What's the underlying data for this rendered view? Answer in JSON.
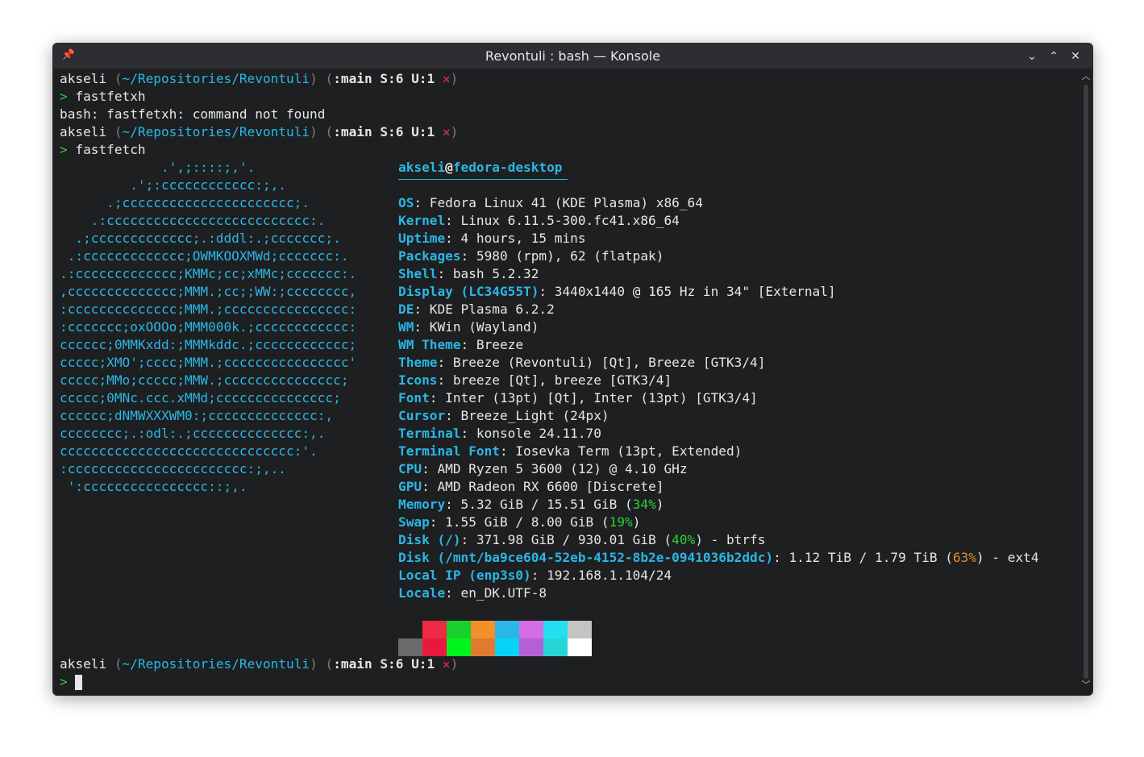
{
  "window": {
    "title": "Revontuli : bash — Konsole",
    "pin_icon": "📌",
    "minimize_icon": "⌄",
    "maximize_icon": "⌃",
    "close_icon": "✕"
  },
  "prompt": {
    "user": "akseli",
    "dir_open": "(",
    "dir": "~/Repositories/Revontuli",
    "dir_close": ")",
    "git_open": "(",
    "git_icon": "",
    "git_branch": ":main",
    "git_status": "S:6 U:1",
    "error_mark": "✕",
    "git_close": ")",
    "arrow": ">"
  },
  "commands": {
    "first": "fastfetxh",
    "error": "bash: fastfetxh: command not found",
    "second": "fastfetch"
  },
  "logo": [
    "             .',;::::;,'.",
    "         .';:cccccccccccc:;,.",
    "      .;cccccccccccccccccccccc;.",
    "    .:cccccccccccccccccccccccccc:.",
    "  .;ccccccccccccc;.:dddl:.;ccccccc;.",
    " .:ccccccccccccc;OWMKOOXMWd;ccccccc:.",
    ".:ccccccccccccc;KMMc;cc;xMMc;ccccccc:.",
    ",cccccccccccccc;MMM.;cc;;WW:;cccccccc,",
    ":cccccccccccccc;MMM.;cccccccccccccccc:",
    ":ccccccc;oxOOOo;MMM000k.;cccccccccccc:",
    "cccccc;0MMKxdd:;MMMkddc.;cccccccccccc;",
    "ccccc;XMO';cccc;MMM.;cccccccccccccccc'",
    "ccccc;MMo;ccccc;MMW.;ccccccccccccccc;",
    "ccccc;0MNc.ccc.xMMd;ccccccccccccccc;",
    "cccccc;dNMWXXXWM0:;cccccccccccccc:,",
    "cccccccc;.:odl:.;cccccccccccccc:,.",
    "cccccccccccccccccccccccccccccc:'.",
    ":ccccccccccccccccccccccc:;,..",
    " ':cccccccccccccccc::;,."
  ],
  "info": {
    "user": "akseli",
    "at": "@",
    "host": "fedora-desktop",
    "rows": [
      {
        "key": "OS",
        "value": ": Fedora Linux 41 (KDE Plasma) x86_64"
      },
      {
        "key": "Kernel",
        "value": ": Linux 6.11.5-300.fc41.x86_64"
      },
      {
        "key": "Uptime",
        "value": ": 4 hours, 15 mins"
      },
      {
        "key": "Packages",
        "value": ": 5980 (rpm), 62 (flatpak)"
      },
      {
        "key": "Shell",
        "value": ": bash 5.2.32"
      },
      {
        "key": "Display (LC34G55T)",
        "value": ": 3440x1440 @ 165 Hz in 34\" [External]"
      },
      {
        "key": "DE",
        "value": ": KDE Plasma 6.2.2"
      },
      {
        "key": "WM",
        "value": ": KWin (Wayland)"
      },
      {
        "key": "WM Theme",
        "value": ": Breeze"
      },
      {
        "key": "Theme",
        "value": ": Breeze (Revontuli) [Qt], Breeze [GTK3/4]"
      },
      {
        "key": "Icons",
        "value": ": breeze [Qt], breeze [GTK3/4]"
      },
      {
        "key": "Font",
        "value": ": Inter (13pt) [Qt], Inter (13pt) [GTK3/4]"
      },
      {
        "key": "Cursor",
        "value": ": Breeze_Light (24px)"
      },
      {
        "key": "Terminal",
        "value": ": konsole 24.11.70"
      },
      {
        "key": "Terminal Font",
        "value": ": Iosevka Term (13pt, Extended)"
      },
      {
        "key": "CPU",
        "value": ": AMD Ryzen 5 3600 (12) @ 4.10 GHz"
      },
      {
        "key": "GPU",
        "value": ": AMD Radeon RX 6600 [Discrete]"
      }
    ],
    "memory": {
      "key": "Memory",
      "pre": ": 5.32 GiB / 15.51 GiB (",
      "pct": "34%",
      "post": ")"
    },
    "swap": {
      "key": "Swap",
      "pre": ": 1.55 GiB / 8.00 GiB (",
      "pct": "19%",
      "post": ")"
    },
    "disk1": {
      "key": "Disk (/)",
      "pre": ": 371.98 GiB / 930.01 GiB (",
      "pct": "40%",
      "post": ") - btrfs"
    },
    "disk2": {
      "key": "Disk (/mnt/ba9ce604-52eb-4152-8b2e-0941036b2ddc)",
      "pre": ": 1.12 TiB / 1.79 TiB (",
      "pct": "63%",
      "post": ") - ext4"
    },
    "local_ip": {
      "key": "Local IP (enp3s0)",
      "value": ": 192.168.1.104/24"
    },
    "locale": {
      "key": "Locale",
      "value": ": en_DK.UTF-8"
    }
  },
  "palette": {
    "top": [
      "#1e1f21",
      "#ee2b44",
      "#1ad02a",
      "#f3902c",
      "#2ab7e6",
      "#d46ee6",
      "#24dff0",
      "#c4c4c4"
    ],
    "bottom": [
      "#6b6b6b",
      "#e8193e",
      "#00f51a",
      "#e07a2e",
      "#06d3f5",
      "#b45fd6",
      "#27d5d5",
      "#ffffff"
    ]
  },
  "colors": {
    "background": "#1e1f21",
    "accent": "#2ab7e6",
    "text": "#e6e6e6"
  }
}
